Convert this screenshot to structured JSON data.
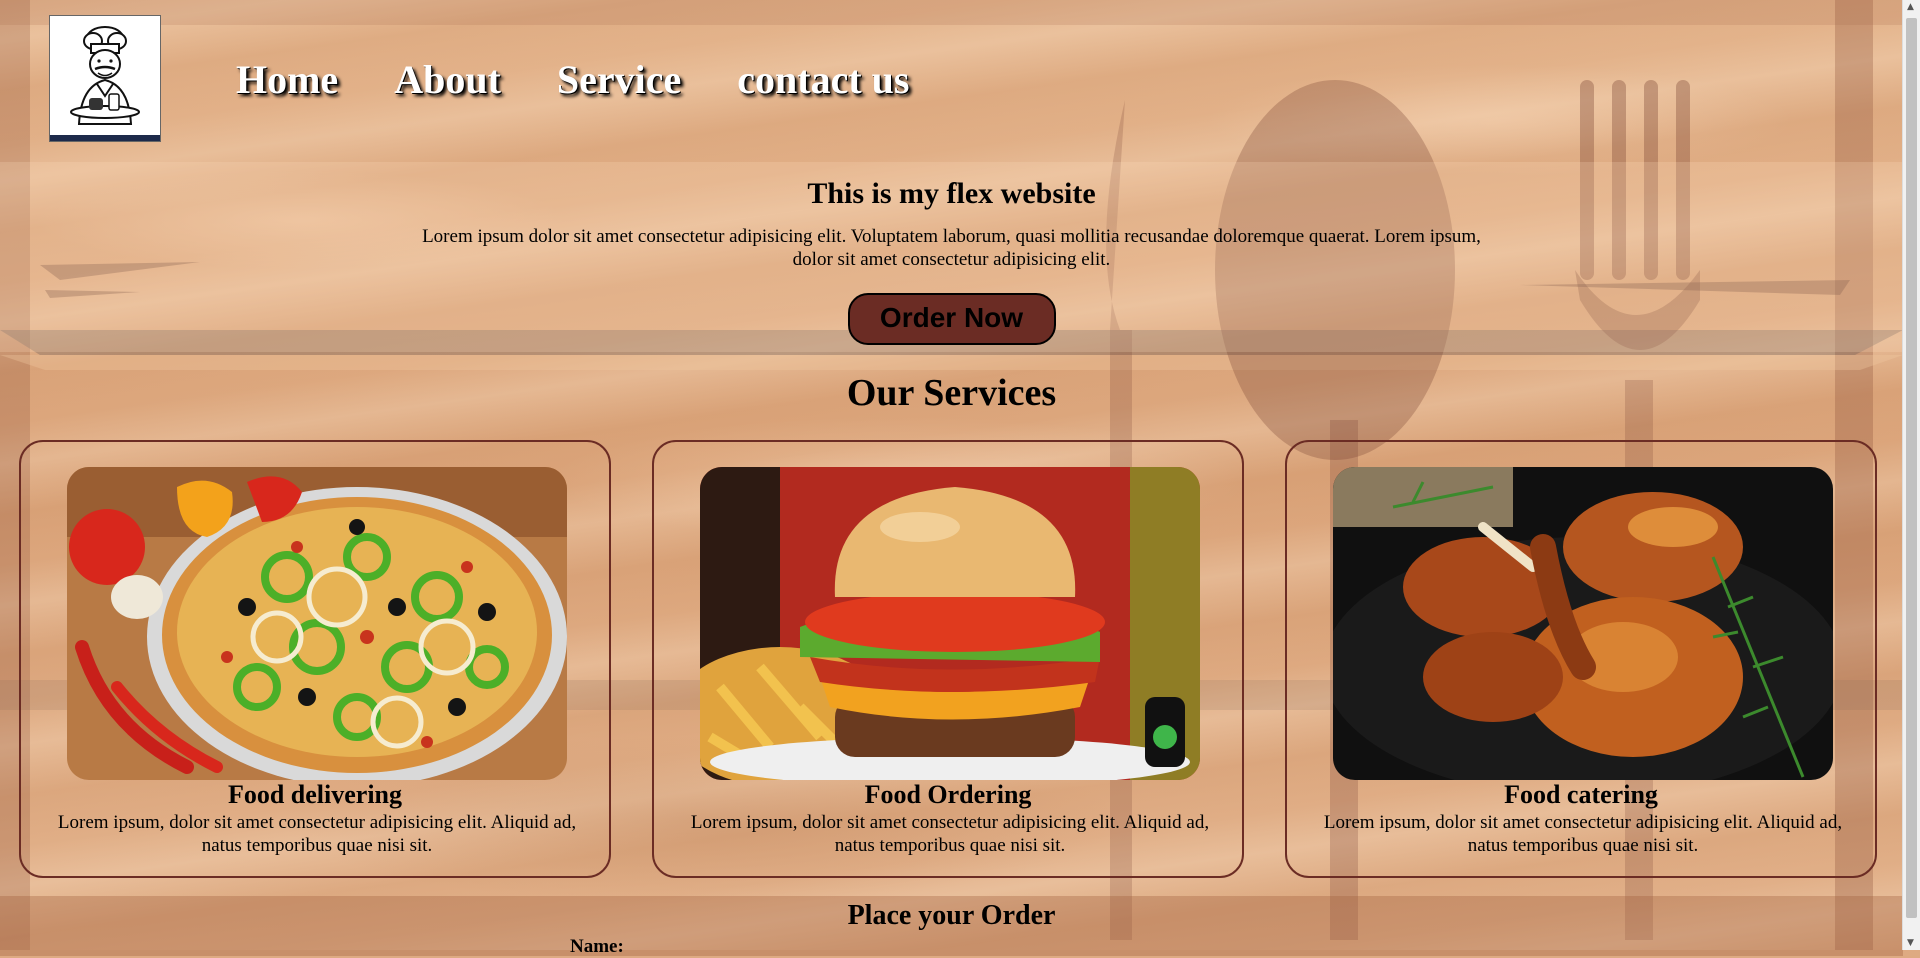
{
  "nav": {
    "items": [
      {
        "label": "Home"
      },
      {
        "label": "About"
      },
      {
        "label": "Service"
      },
      {
        "label": "contact us"
      }
    ]
  },
  "hero": {
    "title": "This is my flex website",
    "text": "Lorem ipsum dolor sit amet consectetur adipisicing elit. Voluptatem laborum, quasi mollitia recusandae doloremque quaerat. Lorem ipsum, dolor sit amet consectetur adipisicing elit.",
    "button_label": "Order Now"
  },
  "services": {
    "title": "Our Services",
    "cards": [
      {
        "title": "Food delivering",
        "text": "Lorem ipsum, dolor sit amet consectetur adipisicing elit. Aliquid ad, natus temporibus quae nisi sit.",
        "image_icon": "pizza-image"
      },
      {
        "title": "Food Ordering",
        "text": "Lorem ipsum, dolor sit amet consectetur adipisicing elit. Aliquid ad, natus temporibus quae nisi sit.",
        "image_icon": "burger-image"
      },
      {
        "title": "Food catering",
        "text": "Lorem ipsum, dolor sit amet consectetur adipisicing elit. Aliquid ad, natus temporibus quae nisi sit.",
        "image_icon": "chicken-image"
      }
    ]
  },
  "order": {
    "title": "Place your Order",
    "name_label": "Name:"
  },
  "colors": {
    "accent": "#6b2c24",
    "background": "#deaa82",
    "nav_text": "#ffffff"
  }
}
